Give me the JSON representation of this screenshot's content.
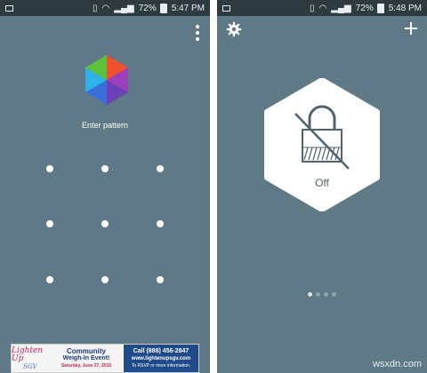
{
  "left_screen": {
    "status": {
      "battery": "72%",
      "time": "5:47 PM"
    },
    "prompt": "Enter pattern",
    "menu_icon": "kebab-menu-icon",
    "app_icon": "hexagon-logo-icon",
    "ad": {
      "logo_line1": "Lighten Up",
      "logo_line2": "SGV",
      "headline1": "Community",
      "headline2": "Weigh-In Event!",
      "date": "Saturday, June 27, 2015",
      "call": "Call (888) 456-2847",
      "url": "www.lightenupsgv.com",
      "rsvp": "To RSVP or more information."
    }
  },
  "right_screen": {
    "status": {
      "battery": "72%",
      "time": "5:48 PM"
    },
    "settings_icon": "gear-icon",
    "add_icon": "plus-icon",
    "lock_status": "Off",
    "pages": {
      "count": 4,
      "active": 0
    }
  },
  "watermark": "wsxdn.com",
  "colors": {
    "background": "#5f7a86",
    "statusbar": "#2d3a40",
    "hex": "#ffffff",
    "lock_icon": "#50636d"
  }
}
